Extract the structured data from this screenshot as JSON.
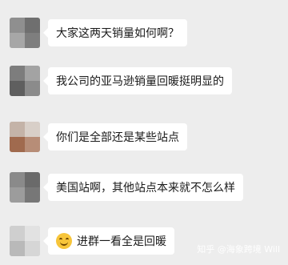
{
  "messages": [
    {
      "text": "大家这两天销量如何啊？"
    },
    {
      "text": "我公司的亚马逊销量回暖挺明显的"
    },
    {
      "text": "你们是全部还是某些站点"
    },
    {
      "text": "美国站啊，其他站点本来就不怎么样"
    },
    {
      "text": "进群一看全是回暖",
      "icon": "grin-sweat-emoji-icon"
    }
  ],
  "watermark": {
    "text": "知乎 @海象跨境 Will"
  },
  "colors": {
    "background": "#ededed",
    "bubble": "#ffffff",
    "text": "#1a1a1a"
  }
}
